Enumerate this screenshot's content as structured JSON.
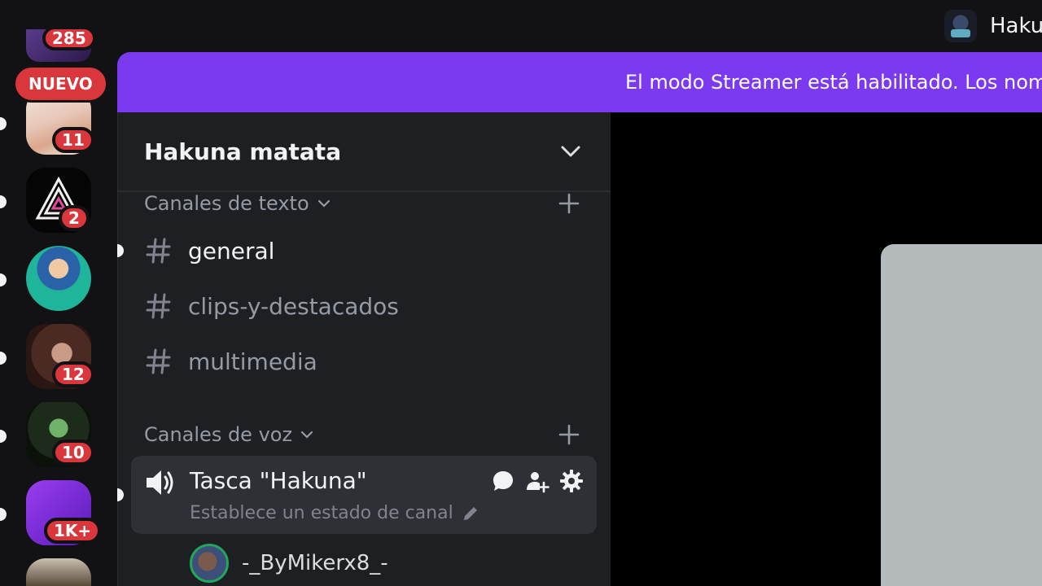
{
  "topbar": {
    "server_name": "Haku",
    "server_icon": "hakuna-matata-server-icon"
  },
  "rail": {
    "new_badge": "NUEVO",
    "items": [
      {
        "badge": "285"
      },
      {
        "badge": "11"
      },
      {
        "badge": "2"
      },
      {
        "badge": ""
      },
      {
        "badge": "12"
      },
      {
        "badge": "10"
      },
      {
        "badge": "1K+"
      },
      {
        "badge": ""
      }
    ]
  },
  "banner": {
    "text": "El modo Streamer está habilitado. Los nom"
  },
  "sidebar": {
    "server_title": "Hakuna matata",
    "text_category": "Canales de texto",
    "voice_category": "Canales de voz",
    "text_channels": [
      {
        "name": "general",
        "unread": true
      },
      {
        "name": "clips-y-destacados",
        "unread": false
      },
      {
        "name": "multimedia",
        "unread": false
      }
    ],
    "voice_channel": {
      "name": "Tasca \"Hakuna\"",
      "status_placeholder": "Establece un estado de canal"
    },
    "voice_members": [
      {
        "name": "-_ByMikerx8_-"
      }
    ]
  },
  "colors": {
    "accent": "#7b3af0",
    "mention": "#da373c",
    "background": "#121214",
    "sidebar": "#1e1f22",
    "voice_active": "#2e3035",
    "online": "#23a55a"
  }
}
